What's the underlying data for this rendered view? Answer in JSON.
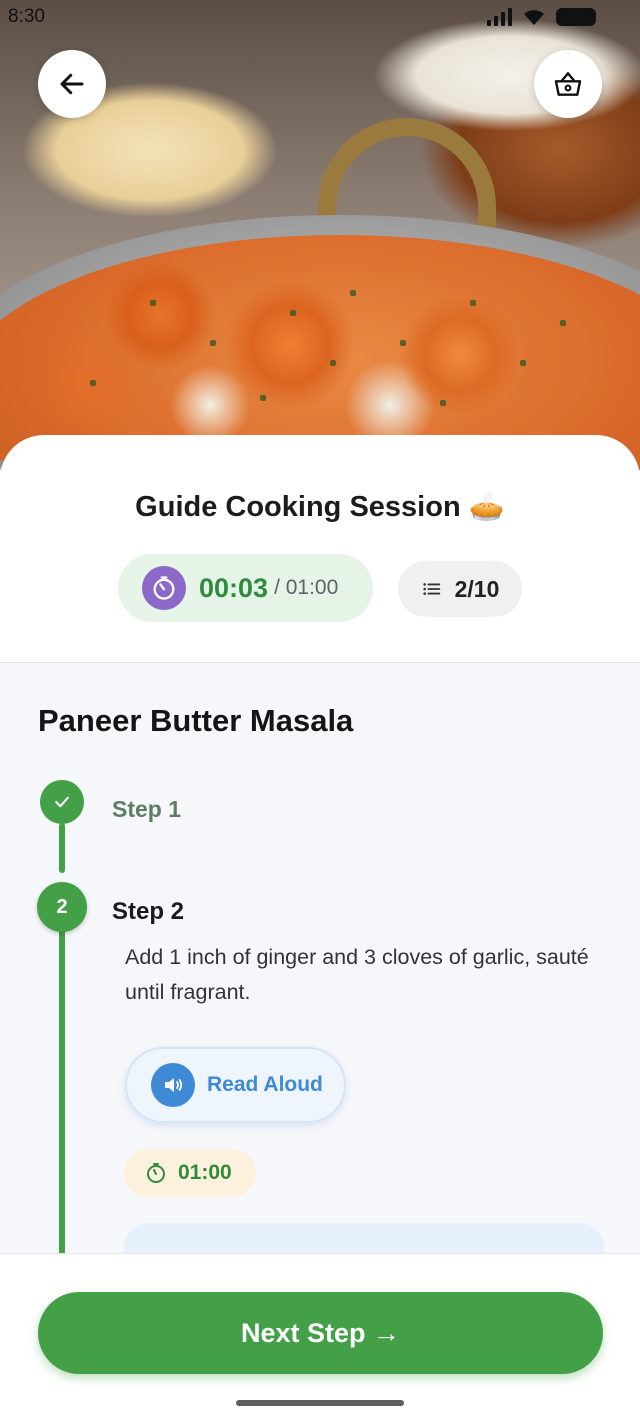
{
  "status_bar": {
    "time": "8:30"
  },
  "header": {
    "title": "Guide Cooking Session 🥧",
    "timer_elapsed": "00:03",
    "timer_total": "/ 01:00",
    "step_counter": "2/10"
  },
  "recipe": {
    "name": "Paneer Butter Masala",
    "steps": [
      {
        "label": "Step 1",
        "state": "completed"
      },
      {
        "label": "Step 2",
        "number": "2",
        "state": "active",
        "text": "Add 1 inch of ginger and 3 cloves of garlic, sauté until fragrant.",
        "read_aloud_label": "Read Aloud",
        "timer": "01:00"
      }
    ]
  },
  "footer": {
    "next_label": "Next Step →"
  },
  "colors": {
    "primary_green": "#43a047",
    "timer_purple": "#8c68c9",
    "accent_blue": "#3f8ad6"
  },
  "icons": [
    "back-arrow-icon",
    "basket-icon",
    "stopwatch-icon",
    "list-icon",
    "check-icon",
    "speaker-icon",
    "timer-icon"
  ]
}
